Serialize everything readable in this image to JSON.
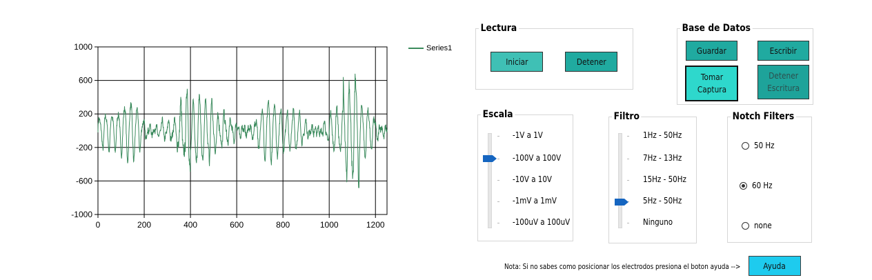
{
  "chart_data": {
    "type": "line",
    "series": [
      {
        "name": "Series1",
        "color": "#3a8a5c"
      }
    ],
    "x_ticks": [
      "0",
      "200",
      "400",
      "600",
      "800",
      "1000",
      "1200"
    ],
    "y_ticks": [
      "1000",
      "600",
      "200",
      "-200",
      "-600",
      "-1000"
    ],
    "xlim": [
      0,
      1250
    ],
    "ylim": [
      -1000,
      1000
    ],
    "grid": true,
    "legend": "top-right",
    "note": "waveform: 1250 samples of a noisy EEG-like signal, amplitude mostly within ±400, peaks to about ±650"
  },
  "lectura": {
    "title": "Lectura",
    "start_label": "Iniciar",
    "stop_label": "Detener"
  },
  "base_datos": {
    "title": "Base de Datos",
    "save_label": "Guardar",
    "write_label": "Escribir",
    "capture_label_1": "Tomar",
    "capture_label_2": "Captura",
    "stop_write_label_1": "Detener",
    "stop_write_label_2": "Escritura"
  },
  "escala": {
    "title": "Escala",
    "options": [
      "-1V a 1V",
      "-100V a 100V",
      "-10V a 10V",
      "-1mV a 1mV",
      "-100uV a 100uV"
    ],
    "selected_index": 1
  },
  "filtro": {
    "title": "Filtro",
    "options": [
      "1Hz - 50Hz",
      "7Hz - 13Hz",
      "15Hz - 50Hz",
      "5Hz - 50Hz",
      "Ninguno"
    ],
    "selected_index": 3
  },
  "notch": {
    "title": "Notch Filters",
    "options": [
      "50 Hz",
      "60 Hz",
      "none"
    ],
    "selected_index": 1
  },
  "footer": {
    "note": "Nota: Si no sabes como posicionar los electrodos presiona el boton ayuda -->",
    "help_label": "Ayuda"
  },
  "colors": {
    "button_teal": "#20aaa0",
    "help_button": "#1ecbee",
    "slider_thumb": "#1565c0",
    "series_line": "#3a8a5c"
  }
}
